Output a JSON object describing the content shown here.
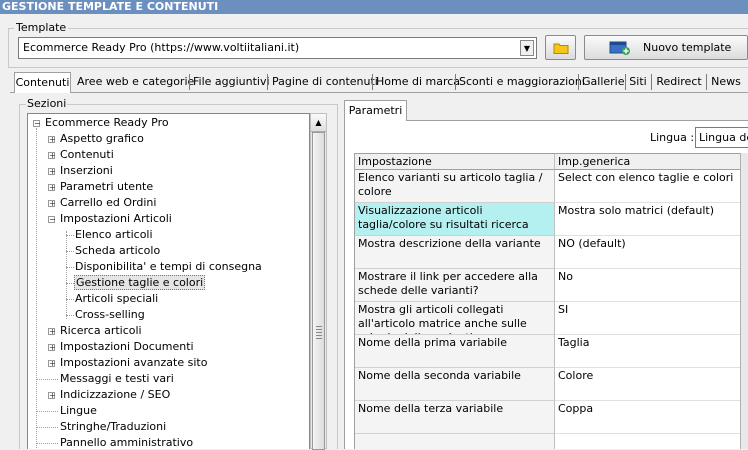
{
  "window": {
    "title": "GESTIONE TEMPLATE E CONTENUTI"
  },
  "template": {
    "label": "Template",
    "selected": "Ecommerce Ready Pro (https://www.voltiitaliani.it)",
    "new_button": "Nuovo template"
  },
  "tabs": [
    {
      "label": "Contenuti"
    },
    {
      "label": "Aree web e categorie"
    },
    {
      "label": "File aggiuntivi"
    },
    {
      "label": "Pagine di contenuti"
    },
    {
      "label": "Home di marca"
    },
    {
      "label": "Sconti e maggiorazioni"
    },
    {
      "label": "Gallerie"
    },
    {
      "label": "Siti"
    },
    {
      "label": "Redirect"
    },
    {
      "label": "News"
    }
  ],
  "sezioni": {
    "label": "Sezioni",
    "root": "Ecommerce Ready Pro",
    "items": [
      "Aspetto grafico",
      "Contenuti",
      "Inserzioni",
      "Parametri utente",
      "Carrello ed Ordini",
      "Impostazioni Articoli",
      "Elenco articoli",
      "Scheda articolo",
      "Disponibilita' e tempi di consegna",
      "Gestione taglie e colori",
      "Articoli speciali",
      "Cross-selling",
      "Ricerca articoli",
      "Impostazioni Documenti",
      "Impostazioni avanzate sito",
      "Messaggi e testi vari",
      "Indicizzazione / SEO",
      "Lingue",
      "Stringhe/Traduzioni",
      "Pannello amministrativo"
    ]
  },
  "parametri": {
    "tab_label": "Parametri",
    "lingua_label": "Lingua :",
    "lingua_value": "Lingua def",
    "headers": [
      "Impostazione",
      "Imp.generica"
    ],
    "rows": [
      [
        "Elenco varianti su articolo taglia / colore",
        "Select con elenco taglie e colori"
      ],
      [
        "Visualizzazione articoli taglia/colore su risultati ricerca",
        "Mostra solo matrici (default)"
      ],
      [
        "Mostra descrizione della variante",
        "NO (default)"
      ],
      [
        "Mostrare il link per accedere alla schede delle varianti?",
        "No"
      ],
      [
        "Mostra gli articoli collegati all'articolo matrice anche sulle schede delle varianti",
        "SI"
      ],
      [
        "Nome della prima variabile",
        "Taglia"
      ],
      [
        "Nome della seconda variabile",
        "Colore"
      ],
      [
        "Nome della terza variabile",
        "Coppa"
      ]
    ]
  },
  "colors": {
    "titlebar": "#6b8fbf",
    "highlight": "#b4f0f0",
    "selected_item": "#e5e5e5"
  }
}
